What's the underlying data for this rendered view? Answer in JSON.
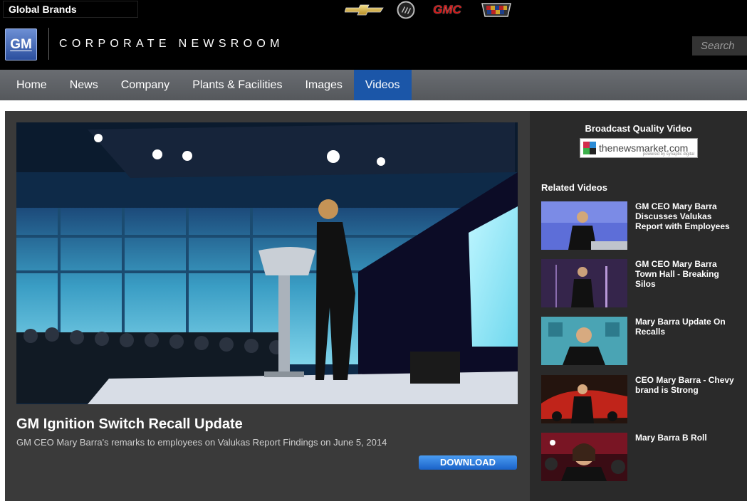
{
  "topbar": {
    "global_brands": "Global Brands",
    "brands": [
      {
        "name": "Chevrolet",
        "icon": "chevrolet-bowtie-icon"
      },
      {
        "name": "Buick",
        "icon": "buick-shield-icon"
      },
      {
        "name": "GMC",
        "icon": "gmc-logo"
      },
      {
        "name": "Cadillac",
        "icon": "cadillac-crest-icon"
      }
    ],
    "gmc_text": "GMC"
  },
  "header": {
    "logo_text": "GM",
    "title": "CORPORATE NEWSROOM",
    "search_placeholder": "Search"
  },
  "nav": {
    "items": [
      {
        "label": "Home",
        "active": false
      },
      {
        "label": "News",
        "active": false
      },
      {
        "label": "Company",
        "active": false
      },
      {
        "label": "Plants & Facilities",
        "active": false
      },
      {
        "label": "Images",
        "active": false
      },
      {
        "label": "Videos",
        "active": true
      }
    ]
  },
  "video": {
    "title": "GM Ignition Switch Recall Update",
    "description": "GM CEO Mary Barra's remarks to employees on Valukas Report Findings on June 5, 2014",
    "download_label": "DOWNLOAD"
  },
  "sidebar": {
    "broadcast_title": "Broadcast Quality Video",
    "newsmarket_text": "thenewsmarket.com",
    "newsmarket_sub": "powered by synaptic digital",
    "related_title": "Related Videos",
    "related": [
      {
        "label": "GM CEO Mary Barra Discusses Valukas Report with Employees"
      },
      {
        "label": "GM CEO Mary Barra Town Hall - Breaking Silos"
      },
      {
        "label": "Mary Barra Update On Recalls"
      },
      {
        "label": "CEO Mary Barra - Chevy brand is Strong"
      },
      {
        "label": "Mary Barra B Roll"
      }
    ]
  },
  "colors": {
    "nav_active": "#1b56a8",
    "download_button": "#2a78de",
    "header_bg": "#000000",
    "content_bg": "#3a3a3a",
    "sidebar_bg": "#2a2a2a"
  }
}
